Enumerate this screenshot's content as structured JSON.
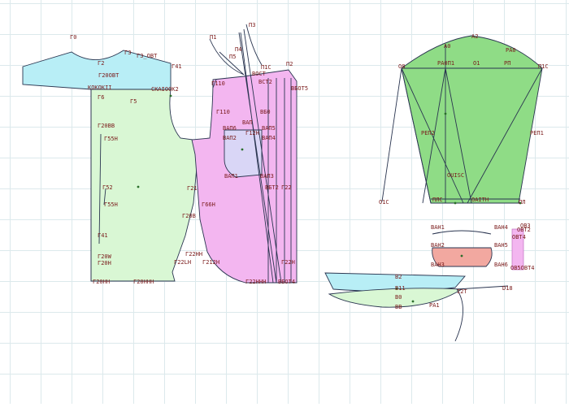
{
  "colors": {
    "grid": "#dce9ec",
    "piece_cyan": "#b8eef6",
    "piece_green_light": "#d9f7d4",
    "piece_green": "#8fdc86",
    "piece_pink": "#f3b6f0",
    "piece_lavender": "#d9d6f6",
    "piece_salmon": "#f2a8a0",
    "line": "#2a3550",
    "label": "#7a1a1a",
    "point": "#2a6e2a"
  },
  "labels": {
    "t0": "Г0",
    "t2": "Г2",
    "t3": "Г3",
    "t3obt": "Г3_OBT",
    "t20obt": "Г20OBT",
    "t41": "Г41",
    "kokokii": "KOKOKII",
    "ckaiook2": "CKAIOOK2",
    "t6": "Г6",
    "t5": "Г5",
    "t20bb": "Г20BB",
    "t55h": "Г55H",
    "t55hb": "Г55H",
    "t52": "Г52",
    "t41b": "Г41",
    "t20w": "Г20W",
    "t20h": "Г20H",
    "t20hh": "Г20HH",
    "t20hhh": "Г20HHH",
    "g21": "Г21",
    "t66h": "Г66H",
    "t20b": "Г20B",
    "t22": "Г22",
    "t22hh": "Г22HH",
    "t22lh": "Г22LH",
    "t212h": "Г212H",
    "p1": "П1",
    "p3": "П3",
    "p4": "П4",
    "p5": "П5",
    "p1c": "П1C",
    "p2": "П2",
    "t110": "Г110",
    "vost": "ВОСТ",
    "vct2": "ВСТ2",
    "t110b": "Г110",
    "vap1": "ВАП1",
    "vap6": "ВАП6",
    "vap2": "ВАП2",
    "vap3": "ВАП3",
    "vap4": "ВАП4",
    "vap5": "ВАП5",
    "t12h": "Г12H",
    "t12hh": "Г12HH",
    "vap": "ВАП",
    "vbot5": "ВБОТ5",
    "vbt2": "ВБТ2",
    "g22": "Г22",
    "g22h": "Г22H",
    "g22hhh": "Г22HHH",
    "vbot4": "ВБОТ4",
    "vb0": "ВБ0",
    "vb1": "ВБ1",
    "a0": "А0",
    "a2": "А2",
    "ra0n1": "РА0П1",
    "o1": "О1",
    "rp": "РП",
    "ra0": "РА0",
    "o8": "О8",
    "p1c2": "П1C",
    "rep2": "РЕП2",
    "rep1": "РЕП1",
    "pl": "ПЛ",
    "ouisc": "OUISC",
    "plc": "ПЛС",
    "oaith": "OAITH",
    "o2k": "O2K",
    "o4": "O4",
    "o1c": "O1C",
    "vah1": "ВАН1",
    "vah4": "ВАН4",
    "vah2": "ВАН2",
    "vah5": "ВАН5",
    "vah3": "ВАН3",
    "vah6": "ВАН6",
    "obt3": "OB3",
    "obt2": "OBT2",
    "obt4a": "OBT4",
    "obt5": "OB5OBT4",
    "b2": "В2",
    "b11": "В11",
    "b0": "В0",
    "t2b": "Г2",
    "i2t": "I2T",
    "d18": "D18",
    "bb": "ВВ",
    "ra1": "РА1"
  }
}
